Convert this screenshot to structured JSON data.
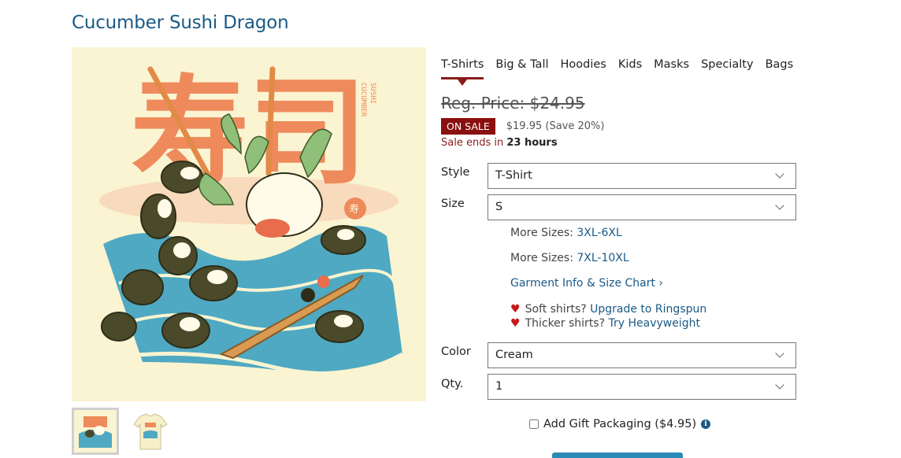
{
  "product": {
    "title": "Cucumber Sushi Dragon"
  },
  "image": {
    "kanji": "寿司",
    "vertical_text_left": "CUCUMBER",
    "vertical_text_right": "SUSHI",
    "stamp_text": "寿"
  },
  "tabs": [
    {
      "label": "T-Shirts",
      "active": true
    },
    {
      "label": "Big & Tall"
    },
    {
      "label": "Hoodies"
    },
    {
      "label": "Kids"
    },
    {
      "label": "Masks"
    },
    {
      "label": "Specialty"
    },
    {
      "label": "Bags"
    }
  ],
  "pricing": {
    "regular": "Reg. Price: $24.95",
    "badge": "ON SALE",
    "sale": "$19.95 (Save 20%)",
    "ends_prefix": "Sale ends in",
    "ends_value": "23 hours"
  },
  "form": {
    "style_label": "Style",
    "style_value": "T-Shirt",
    "size_label": "Size",
    "size_value": "S",
    "color_label": "Color",
    "color_value": "Cream",
    "qty_label": "Qty.",
    "qty_value": "1"
  },
  "sizes": {
    "more1_label": "More Sizes:",
    "more1_link": "3XL-6XL",
    "more2_label": "More Sizes:",
    "more2_link": "7XL-10XL",
    "chart_link": "Garment Info & Size Chart ›"
  },
  "upsell": {
    "soft_text": "Soft shirts?",
    "soft_link": "Upgrade to Ringspun",
    "thick_text": "Thicker shirts?",
    "thick_link": "Try Heavyweight"
  },
  "gift": {
    "label": "Add Gift Packaging ($4.95)"
  },
  "colors": {
    "brand_link": "#1a5a86",
    "sale_red": "#8a0f0f",
    "art_bg": "#fbf4d2",
    "art_orange": "#ee8a5b",
    "art_teal": "#4fa9c2"
  }
}
